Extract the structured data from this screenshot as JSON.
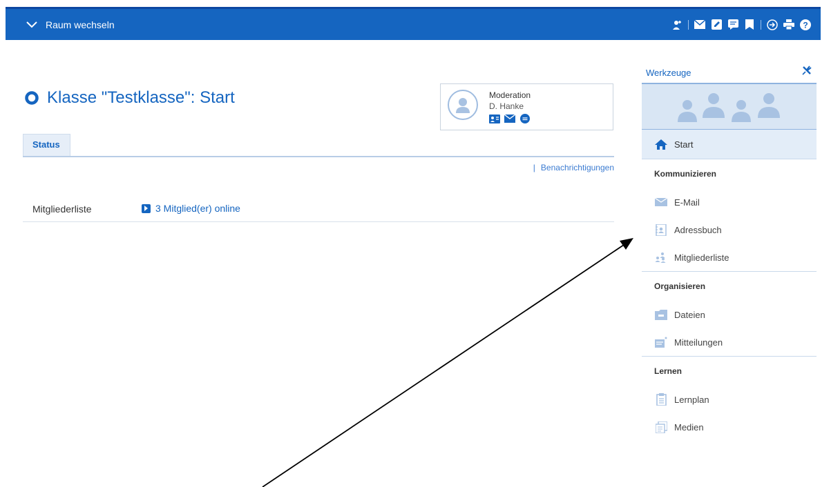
{
  "topbar": {
    "room_switch_label": "Raum wechseln",
    "bg_color": "#1565c0"
  },
  "page": {
    "title": "Klasse \"Testklasse\": Start"
  },
  "moderation": {
    "title": "Moderation",
    "name": "D. Hanke"
  },
  "tabs": [
    {
      "label": "Status"
    }
  ],
  "notifications_link": "Benachrichtigungen",
  "members": {
    "label": "Mitgliederliste",
    "online_text": "3 Mitglied(er) online"
  },
  "sidebar": {
    "title": "Werkzeuge",
    "start_label": "Start",
    "sections": [
      {
        "title": "Kommunizieren",
        "items": [
          {
            "label": "E-Mail",
            "icon": "mail-icon"
          },
          {
            "label": "Adressbuch",
            "icon": "addressbook-icon"
          },
          {
            "label": "Mitgliederliste",
            "icon": "members-icon"
          }
        ]
      },
      {
        "title": "Organisieren",
        "items": [
          {
            "label": "Dateien",
            "icon": "folder-icon"
          },
          {
            "label": "Mitteilungen",
            "icon": "messages-icon"
          }
        ]
      },
      {
        "title": "Lernen",
        "items": [
          {
            "label": "Lernplan",
            "icon": "clipboard-icon"
          },
          {
            "label": "Medien",
            "icon": "media-icon"
          }
        ]
      }
    ]
  }
}
